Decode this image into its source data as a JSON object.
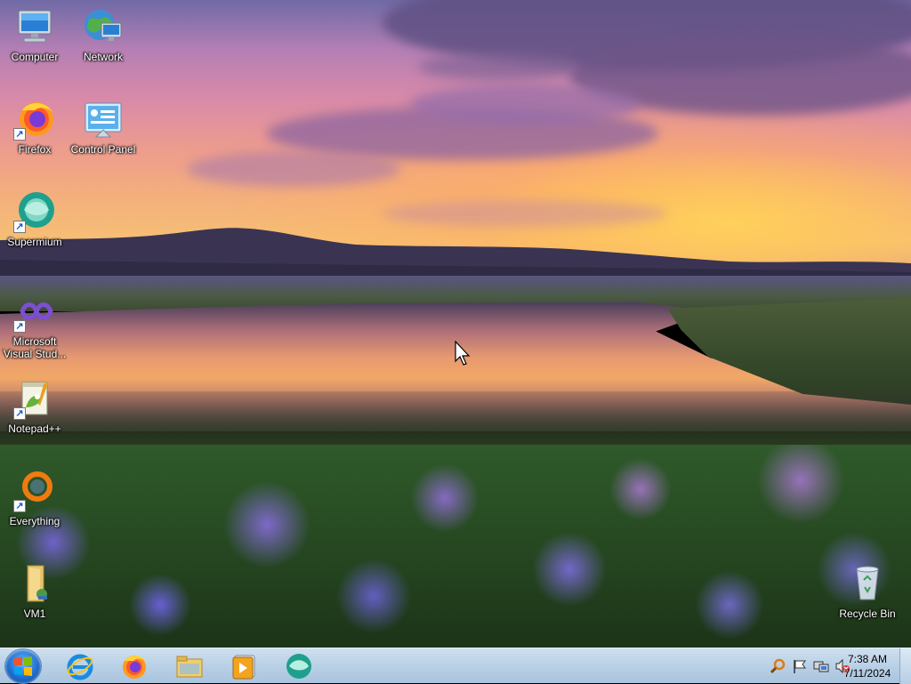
{
  "desktop": {
    "icons": [
      {
        "label": "Computer",
        "icon": "computer-icon"
      },
      {
        "label": "Network",
        "icon": "network-icon"
      },
      {
        "label": "Firefox",
        "icon": "firefox-icon"
      },
      {
        "label": "Control Panel",
        "icon": "control-panel-icon"
      },
      {
        "label": "Supermium",
        "icon": "supermium-icon"
      },
      {
        "label": "Microsoft Visual Stud...",
        "icon": "visual-studio-icon"
      },
      {
        "label": "Notepad++",
        "icon": "notepad-plus-plus-icon"
      },
      {
        "label": "Everything",
        "icon": "everything-search-icon"
      },
      {
        "label": "VM1",
        "icon": "folder-icon"
      },
      {
        "label": "Recycle Bin",
        "icon": "recycle-bin-icon"
      }
    ]
  },
  "taskbar": {
    "start_icon": "windows-start-icon",
    "pinned": [
      {
        "name": "Internet Explorer",
        "icon": "internet-explorer-icon"
      },
      {
        "name": "Firefox",
        "icon": "firefox-icon"
      },
      {
        "name": "File Explorer",
        "icon": "file-explorer-icon"
      },
      {
        "name": "Media Player",
        "icon": "media-player-icon"
      },
      {
        "name": "Supermium",
        "icon": "supermium-icon"
      }
    ],
    "tray": {
      "icons": [
        "search-magnifier-icon",
        "action-center-flag-icon",
        "network-monitor-icon",
        "volume-muted-icon"
      ],
      "time": "7:38 AM",
      "date": "7/11/2024"
    }
  },
  "colors": {
    "taskbar_top": "#cfe0ef",
    "taskbar_bottom": "#a9c4de",
    "label_text": "#ffffff"
  }
}
